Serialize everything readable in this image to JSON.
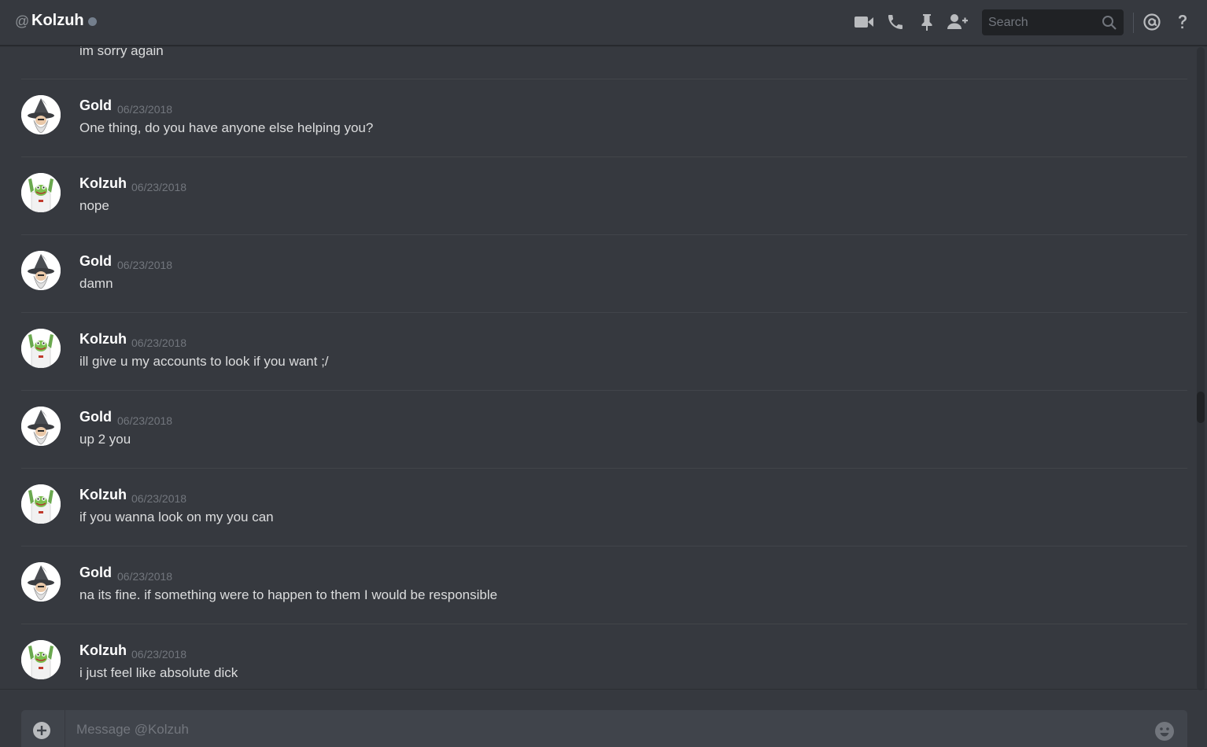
{
  "header": {
    "at_symbol": "@",
    "channel_name": "Kolzuh",
    "search_placeholder": "Search",
    "icons": [
      "video-camera-icon",
      "phone-icon",
      "pin-icon",
      "add-friend-icon",
      "search-icon",
      "mention-icon",
      "help-icon"
    ]
  },
  "messages": {
    "continued_text": "im sorry again",
    "groups": [
      {
        "author": "Gold",
        "timestamp": "06/23/2018",
        "text": "One thing, do you have anyone else helping you?",
        "avatar": "wizard"
      },
      {
        "author": "Kolzuh",
        "timestamp": "06/23/2018",
        "text": "nope",
        "avatar": "frog"
      },
      {
        "author": "Gold",
        "timestamp": "06/23/2018",
        "text": "damn",
        "avatar": "wizard"
      },
      {
        "author": "Kolzuh",
        "timestamp": "06/23/2018",
        "text": "ill give u my accounts to look if you want ;/",
        "avatar": "frog"
      },
      {
        "author": "Gold",
        "timestamp": "06/23/2018",
        "text": "up 2 you",
        "avatar": "wizard"
      },
      {
        "author": "Kolzuh",
        "timestamp": "06/23/2018",
        "text": "if you wanna look on my you can",
        "avatar": "frog"
      },
      {
        "author": "Gold",
        "timestamp": "06/23/2018",
        "text": "na its fine. if something were to happen to them I would be responsible",
        "avatar": "wizard"
      },
      {
        "author": "Kolzuh",
        "timestamp": "06/23/2018",
        "text": "i just feel like absolute dick",
        "avatar": "frog"
      }
    ]
  },
  "composer": {
    "placeholder": "Message @Kolzuh"
  },
  "colors": {
    "background": "#36393f",
    "input": "#40444b",
    "status_offline": "#747f8d",
    "timestamp": "#72767d"
  }
}
